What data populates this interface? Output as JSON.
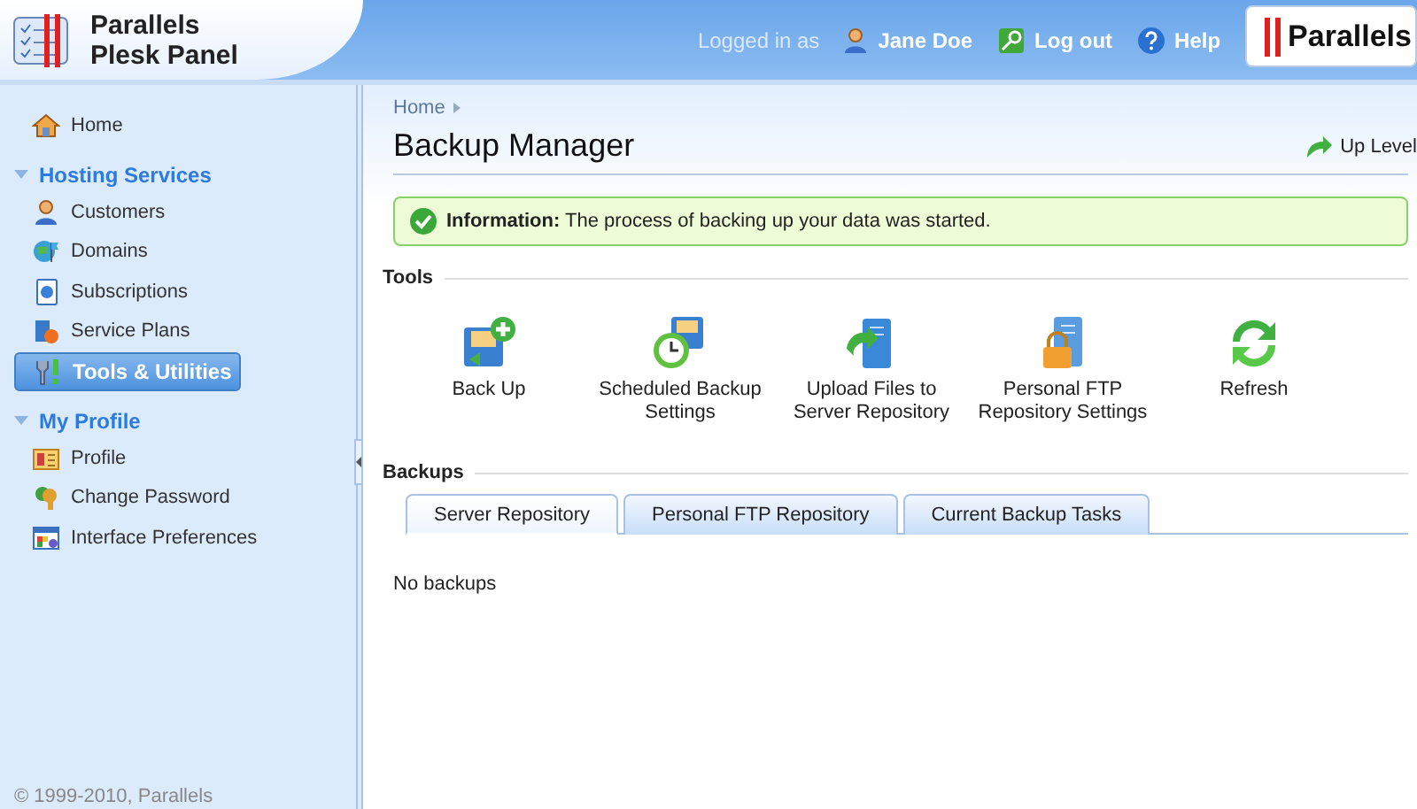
{
  "header": {
    "product_name": "Parallels Plesk Panel",
    "logged_in_label": "Logged in as",
    "user": "Jane Doe",
    "logout": "Log out",
    "help": "Help",
    "brand_logo": "Parallels"
  },
  "sidebar": {
    "top_items": [
      {
        "label": "Home",
        "selected": false
      }
    ],
    "sections": [
      {
        "title": "Hosting Services",
        "expanded": true,
        "items": [
          {
            "label": "Customers",
            "selected": false
          },
          {
            "label": "Domains",
            "selected": false
          },
          {
            "label": "Subscriptions",
            "selected": false
          },
          {
            "label": "Service Plans",
            "selected": false
          },
          {
            "label": "Tools & Utilities",
            "selected": true
          }
        ]
      },
      {
        "title": "My Profile",
        "expanded": true,
        "items": [
          {
            "label": "Profile",
            "selected": false
          },
          {
            "label": "Change Password",
            "selected": false
          },
          {
            "label": "Interface Preferences",
            "selected": false
          }
        ]
      }
    ],
    "copyright": "© 1999-2010, Parallels"
  },
  "content": {
    "breadcrumb": [
      "Home"
    ],
    "title": "Backup Manager",
    "up_level": "Up Level",
    "message": {
      "text": "**Information:** The process of backing up your data was started."
    },
    "tools_section": {
      "title": "Tools",
      "tools": [
        "Back Up",
        "Scheduled Backup Settings",
        "Upload Files to Server Repository",
        "Personal FTP Repository Settings",
        "Refresh"
      ]
    },
    "backups_section": {
      "title": "Backups",
      "tabs": [
        {
          "label": "Server Repository",
          "selected": true
        },
        {
          "label": "Personal FTP Repository",
          "selected": false
        },
        {
          "label": "Current Backup Tasks",
          "selected": false
        }
      ],
      "empty_text": "No backups"
    }
  }
}
